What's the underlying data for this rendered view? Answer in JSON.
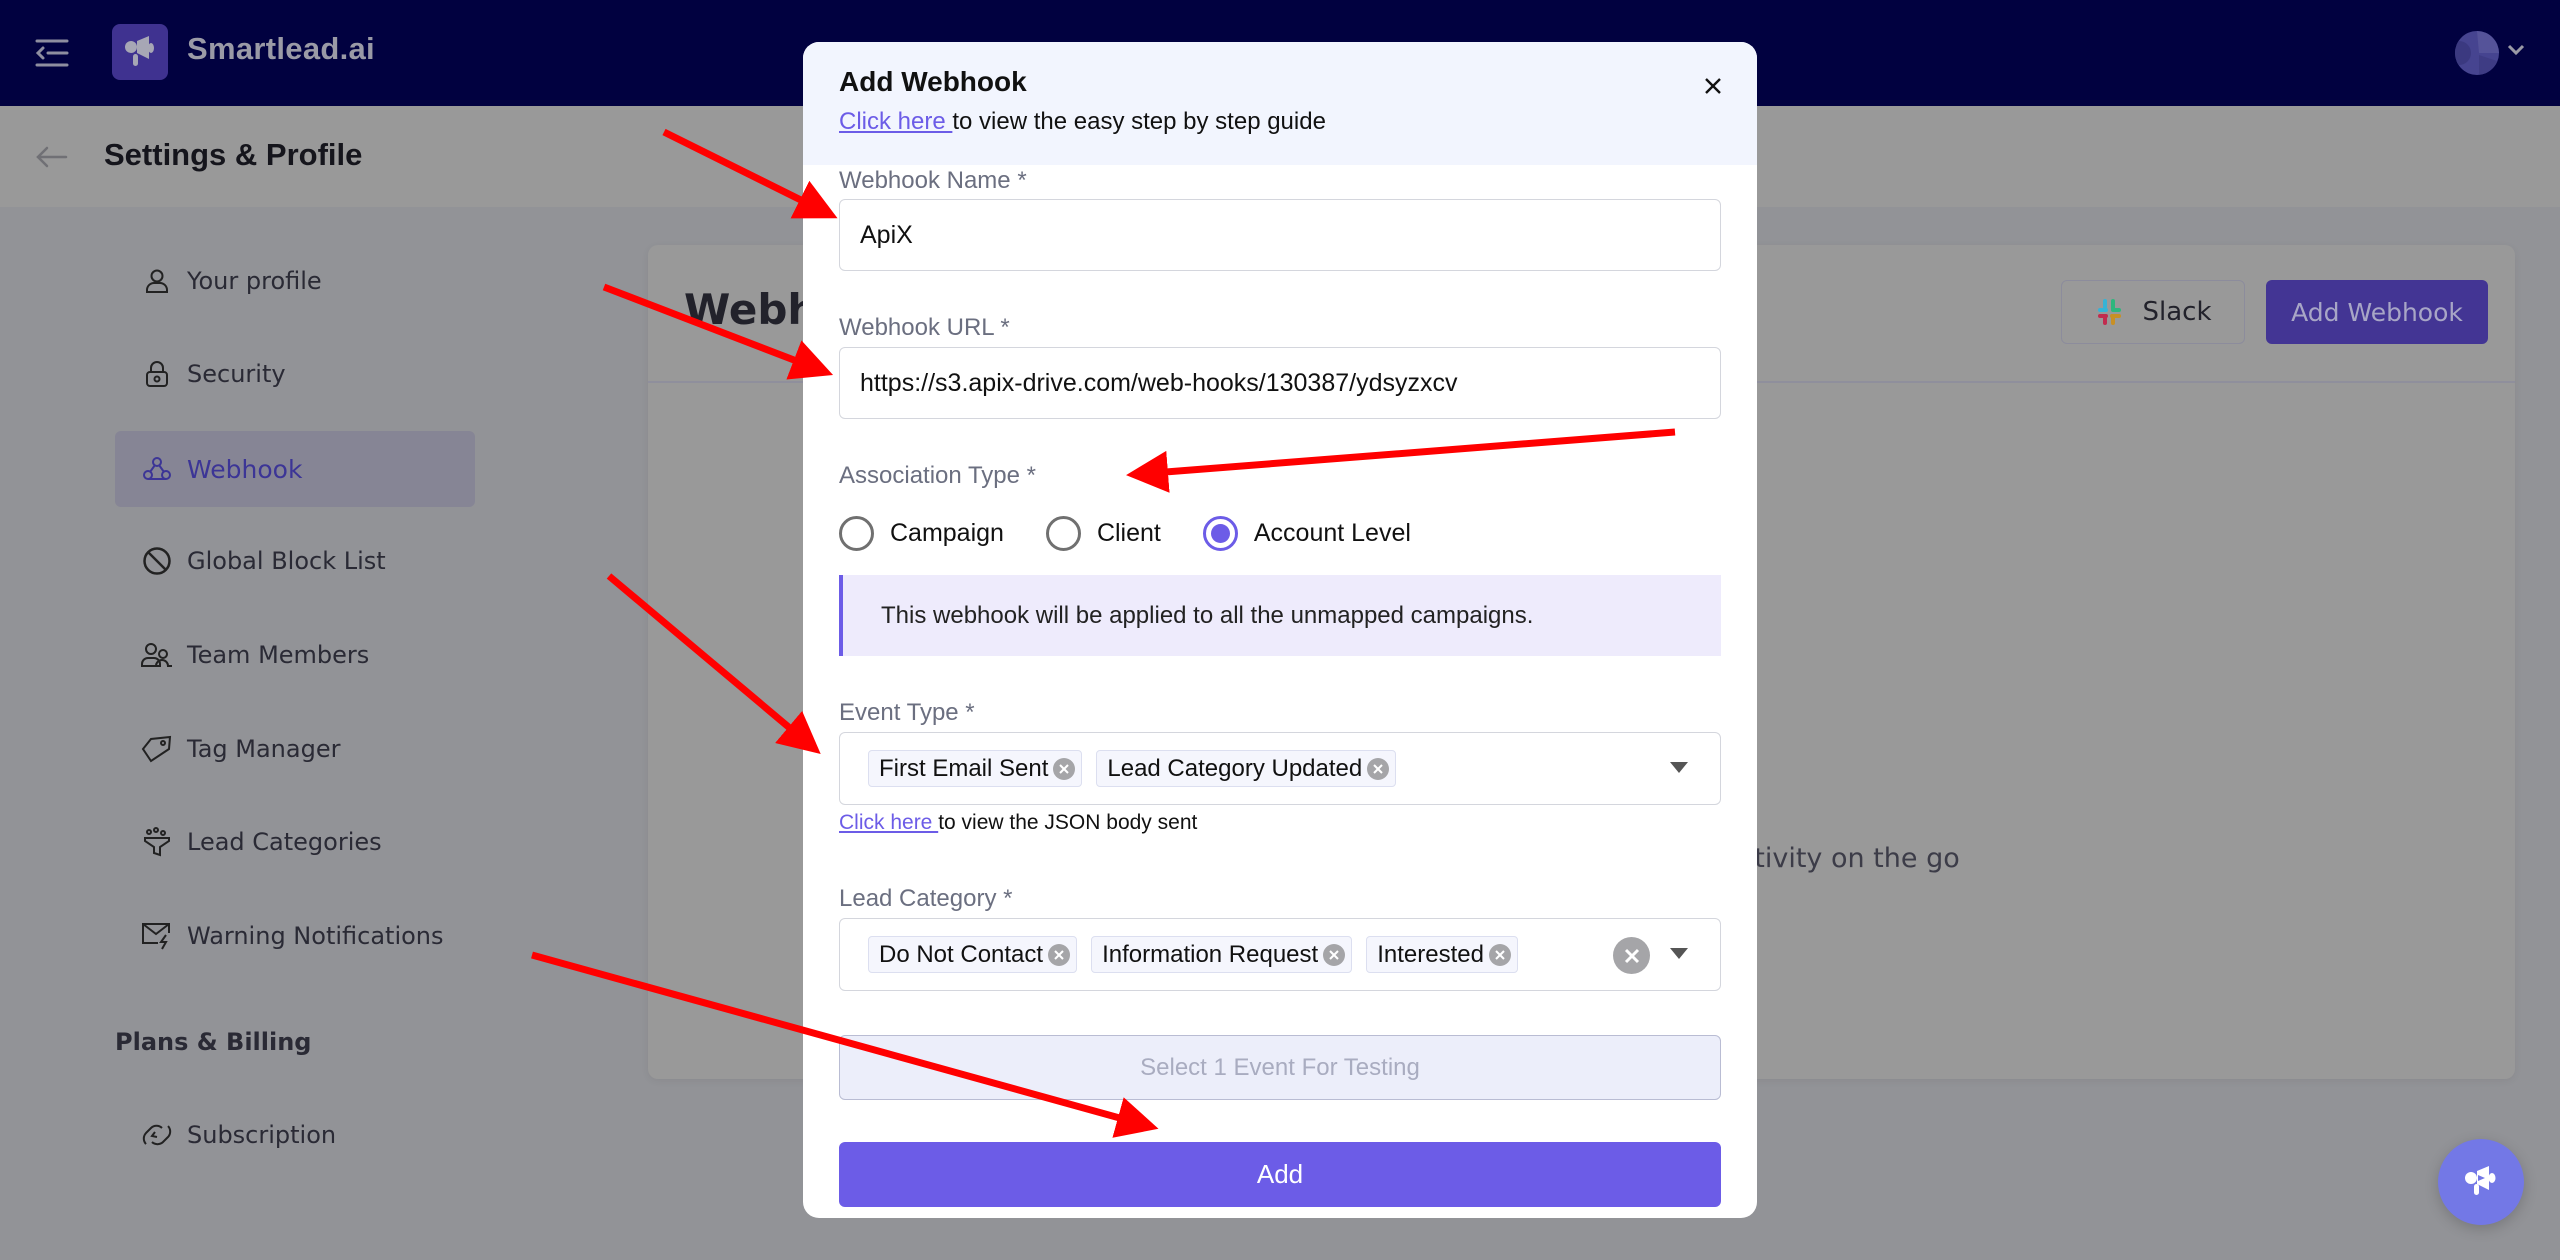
{
  "app": {
    "brand": "Smartlead.ai",
    "accent_color": "#6c5ce7",
    "nav_color": "#010140"
  },
  "header": {
    "title": "Settings & Profile",
    "back_icon": "arrow-left-icon"
  },
  "sidebar": {
    "items": [
      {
        "label": "Your profile",
        "icon": "user-icon",
        "active": false
      },
      {
        "label": "Security",
        "icon": "lock-icon",
        "active": false
      },
      {
        "label": "Webhook",
        "icon": "webhook-icon",
        "active": true
      },
      {
        "label": "Global Block List",
        "icon": "block-icon",
        "active": false
      },
      {
        "label": "Team Members",
        "icon": "team-icon",
        "active": false
      },
      {
        "label": "Tag Manager",
        "icon": "tag-icon",
        "active": false
      },
      {
        "label": "Lead Categories",
        "icon": "funnel-icon",
        "active": false
      },
      {
        "label": "Warning Notifications",
        "icon": "mail-alert-icon",
        "active": false
      }
    ],
    "section": "Plans & Billing",
    "section_items": [
      {
        "label": "Subscription",
        "icon": "subscription-icon"
      }
    ]
  },
  "card": {
    "title": "Webhooks",
    "slack_label": "Slack",
    "add_webhook_label": "Add Webhook",
    "empty_title_visible": "t",
    "empty_subtitle_visible": "ampaign activity on the go"
  },
  "modal": {
    "title": "Add Webhook",
    "guide_link": "Click here ",
    "guide_text": "to view the easy step by step guide",
    "name_label": "Webhook Name *",
    "name_value": "ApiX",
    "url_label": "Webhook URL *",
    "url_value": "https://s3.apix-drive.com/web-hooks/130387/ydsyzxcv",
    "association_label": "Association Type *",
    "association_options": [
      {
        "label": "Campaign",
        "checked": false
      },
      {
        "label": "Client",
        "checked": false
      },
      {
        "label": "Account Level",
        "checked": true
      }
    ],
    "info_text": "This webhook will be applied to all the unmapped campaigns.",
    "event_label": "Event Type *",
    "event_chips": [
      "First Email Sent",
      "Lead Category Updated"
    ],
    "json_link": "Click here ",
    "json_text": "to view the JSON body sent",
    "lead_label": "Lead Category *",
    "lead_chips": [
      "Do Not Contact",
      "Information Request",
      "Interested"
    ],
    "test_label": "Select 1 Event For Testing",
    "add_label": "Add"
  }
}
